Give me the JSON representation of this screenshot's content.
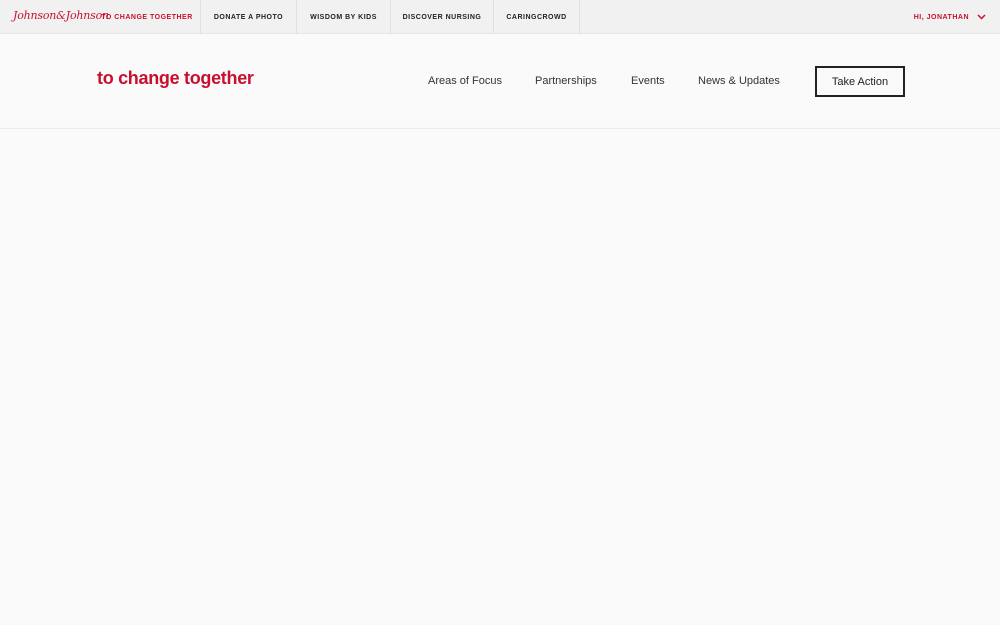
{
  "topbar": {
    "brand": "Johnson&Johnson",
    "links": [
      {
        "label": "TO CHANGE TOGETHER",
        "active": true
      },
      {
        "label": "DONATE A PHOTO",
        "active": false
      },
      {
        "label": "WISDOM BY KIDS",
        "active": false
      },
      {
        "label": "DISCOVER NURSING",
        "active": false
      },
      {
        "label": "CARINGCROWD",
        "active": false
      }
    ],
    "user": {
      "greeting": "HI, JONATHAN",
      "icon": "chevron-down-icon"
    }
  },
  "header": {
    "logo": "to change together",
    "nav": [
      {
        "label": "Areas of Focus"
      },
      {
        "label": "Partnerships"
      },
      {
        "label": "Events"
      },
      {
        "label": "News & Updates"
      }
    ],
    "cta": "Take Action"
  },
  "colors": {
    "brand_red": "#c8102e",
    "text_dark": "#222222",
    "background": "#fafafa",
    "topbar_bg": "#f1f1f1"
  }
}
